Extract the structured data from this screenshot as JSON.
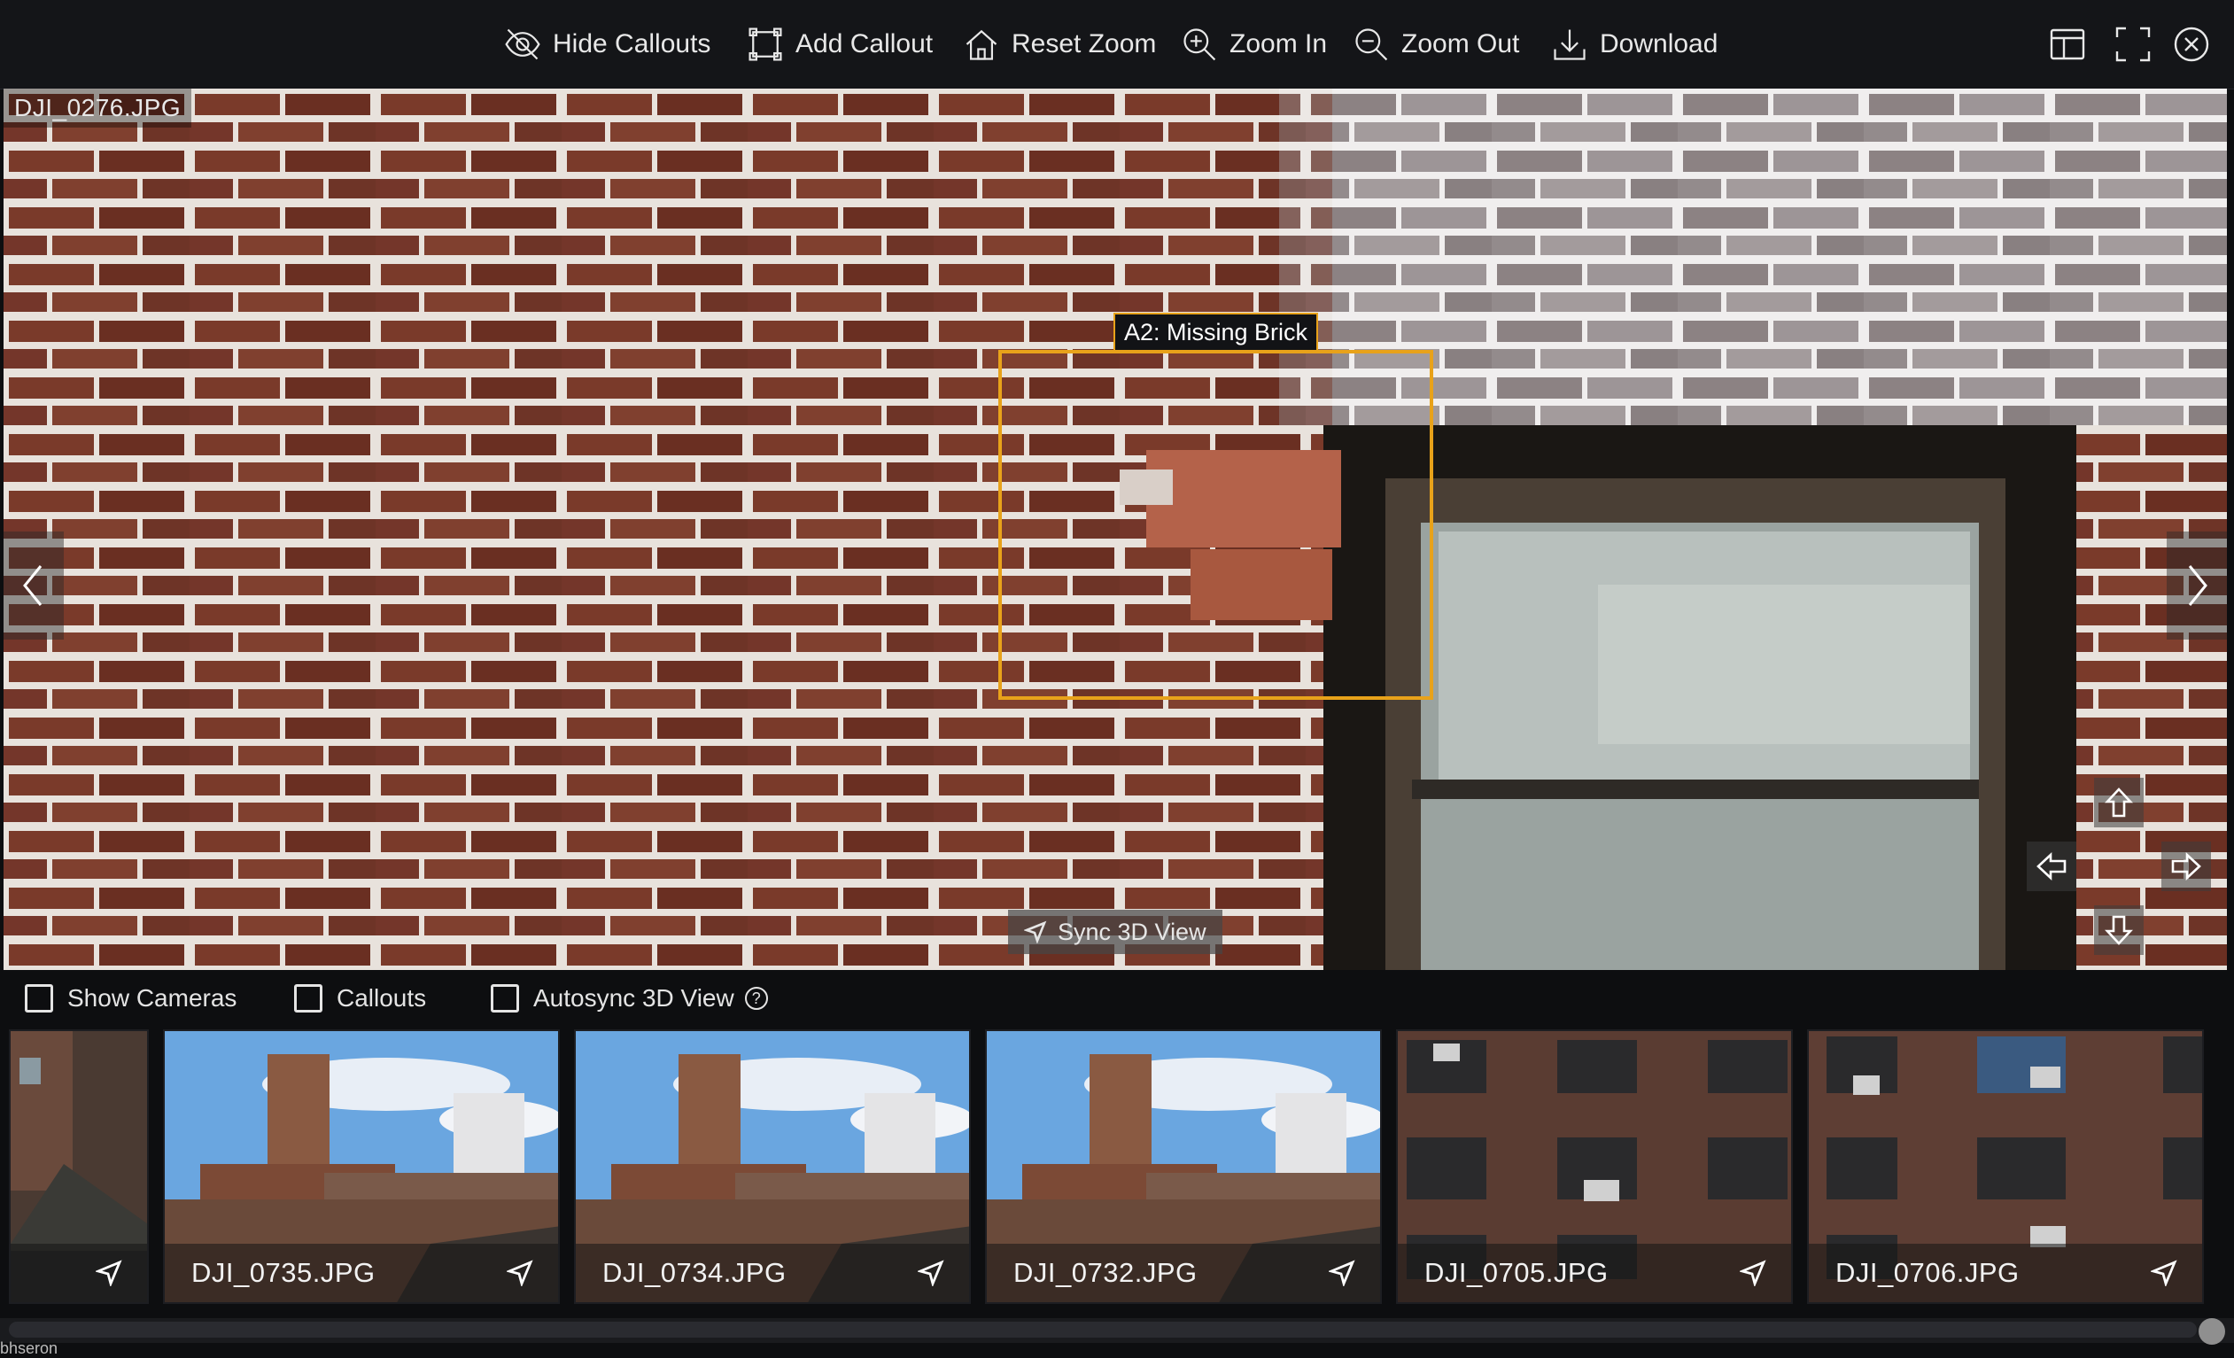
{
  "toolbar": {
    "hide_callouts": "Hide Callouts",
    "add_callout": "Add Callout",
    "reset_zoom": "Reset Zoom",
    "zoom_in": "Zoom In",
    "zoom_out": "Zoom Out",
    "download": "Download"
  },
  "viewer": {
    "file_name": "DJI_0276.JPG",
    "callout_label": "A2: Missing Brick",
    "sync_button": "Sync 3D View"
  },
  "options": {
    "show_cameras": "Show Cameras",
    "callouts": "Callouts",
    "autosync": "Autosync 3D View",
    "help": "?"
  },
  "thumbnails": [
    {
      "name": ""
    },
    {
      "name": "DJI_0735.JPG"
    },
    {
      "name": "DJI_0734.JPG"
    },
    {
      "name": "DJI_0732.JPG"
    },
    {
      "name": "DJI_0705.JPG"
    },
    {
      "name": "DJI_0706.JPG"
    }
  ],
  "colors": {
    "callout_accent": "#e8a21a",
    "background": "#0d0e10",
    "toolbar": "#141518"
  },
  "icons": [
    "eye-slash-icon",
    "callout-frame-icon",
    "home-icon",
    "zoom-in-icon",
    "zoom-out-icon",
    "download-icon",
    "layout-icon",
    "fullscreen-icon",
    "close-icon",
    "chevron-left-icon",
    "chevron-right-icon",
    "location-arrow-icon",
    "arrow-up-icon",
    "arrow-down-icon",
    "arrow-left-icon",
    "arrow-right-icon"
  ],
  "footer_fragment": "bhseron"
}
